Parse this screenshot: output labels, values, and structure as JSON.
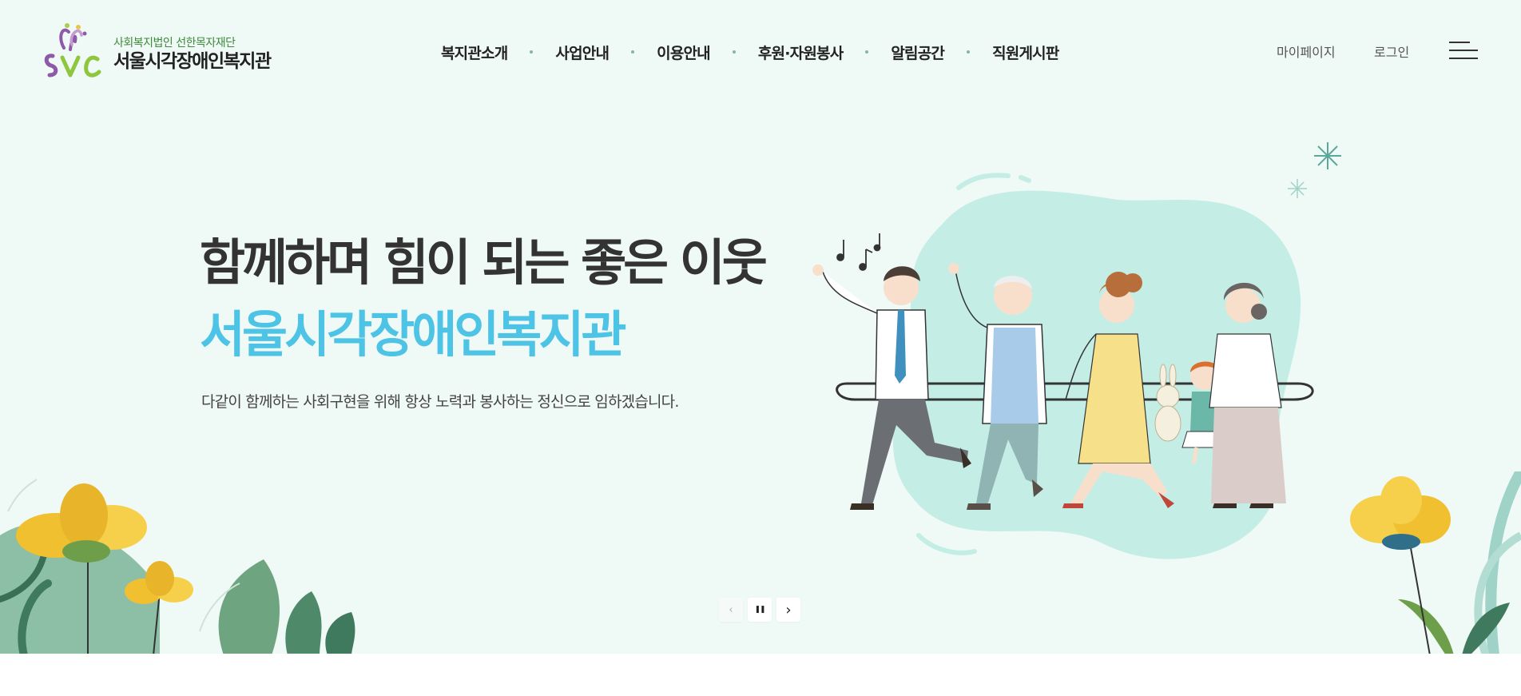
{
  "header": {
    "logo": {
      "subtitle": "사회복지법인 선한목자재단",
      "title": "서울시각장애인복지관",
      "mark_letters": "SVC"
    },
    "nav": [
      {
        "label": "복지관소개"
      },
      {
        "label": "사업안내"
      },
      {
        "label": "이용안내"
      },
      {
        "label": "후원·자원봉사"
      },
      {
        "label": "알림공간"
      },
      {
        "label": "직원게시판"
      }
    ],
    "util": {
      "mypage": "마이페이지",
      "login": "로그인"
    },
    "menu_icon": "hamburger-menu-icon"
  },
  "hero": {
    "title_line1": "함께하며 힘이 되는 좋은 이웃",
    "title_line2": "서울시각장애인복지관",
    "description": "다같이 함께하는 사회구현을 위해 항상 노력과 봉사하는 정신으로 임하겠습니다.",
    "title2_color": "#4dc3e6",
    "background": "#eff9f5"
  },
  "slider_controls": {
    "prev_icon": "chevron-left-icon",
    "pause_icon": "pause-icon",
    "next_icon": "chevron-right-icon",
    "prev_glyph": "‹",
    "pause_glyph": "❚❚",
    "next_glyph": "›"
  }
}
